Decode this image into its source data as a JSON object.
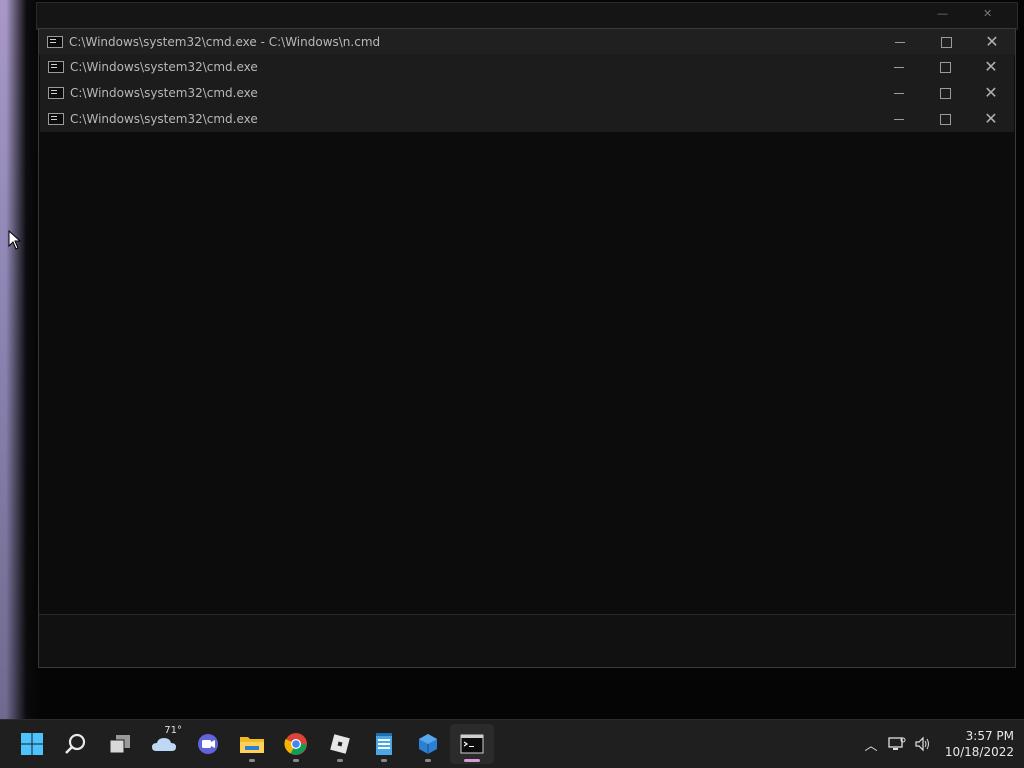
{
  "windows": [
    {
      "title": "C:\\Windows\\system32\\cmd.exe - C:\\Windows\\n.cmd"
    },
    {
      "title": "C:\\Windows\\system32\\cmd.exe"
    },
    {
      "title": "C:\\Windows\\system32\\cmd.exe"
    },
    {
      "title": "C:\\Windows\\system32\\cmd.exe"
    }
  ],
  "taskbar": {
    "items": [
      {
        "icon": "windows-start-icon"
      },
      {
        "icon": "search-icon"
      },
      {
        "icon": "task-view-icon"
      },
      {
        "icon": "weather-icon",
        "badge": "71°"
      },
      {
        "icon": "teams-chat-icon"
      },
      {
        "icon": "file-explorer-icon"
      },
      {
        "icon": "chrome-icon"
      },
      {
        "icon": "roblox-icon"
      },
      {
        "icon": "notepad-icon"
      },
      {
        "icon": "app-cube-icon"
      },
      {
        "icon": "cmd-icon"
      }
    ]
  },
  "tray": {
    "time": "3:57 PM",
    "date": "10/18/2022"
  },
  "colors": {
    "console_bg": "#0c0c0c",
    "taskbar_bg": "#1f1f1f",
    "active_indicator": "#d89bd8"
  }
}
